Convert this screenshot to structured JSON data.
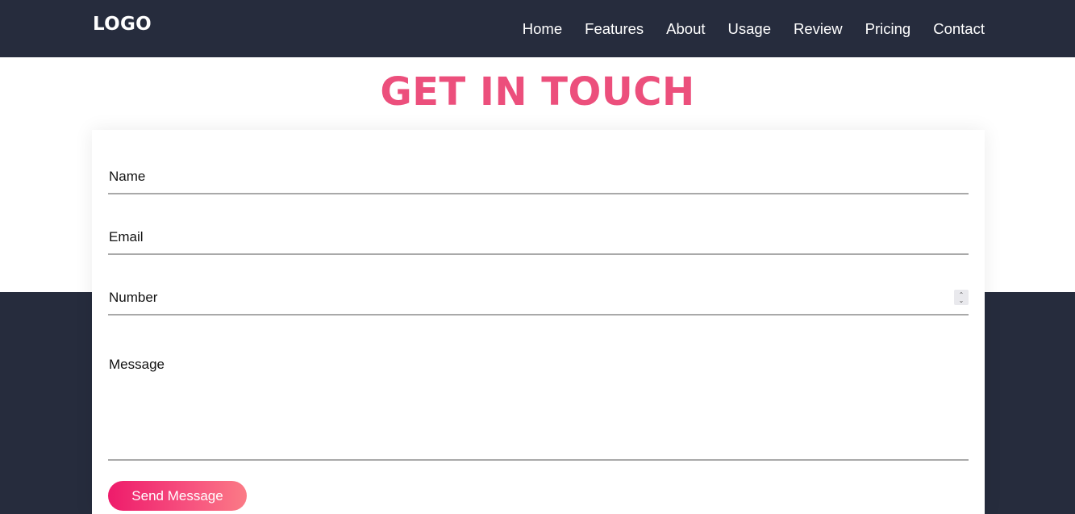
{
  "navbar": {
    "logo": "LOGO",
    "links": [
      "Home",
      "Features",
      "About",
      "Usage",
      "Review",
      "Pricing",
      "Contact"
    ]
  },
  "heading": "GET IN TOUCH",
  "form": {
    "name_placeholder": "Name",
    "email_placeholder": "Email",
    "number_placeholder": "Number",
    "message_placeholder": "Message",
    "submit_label": "Send Message"
  },
  "colors": {
    "navbar_bg": "#262c3d",
    "heading": "#ec4f7c",
    "button_gradient_start": "#ee1b6b",
    "button_gradient_end": "#fb7b86"
  }
}
